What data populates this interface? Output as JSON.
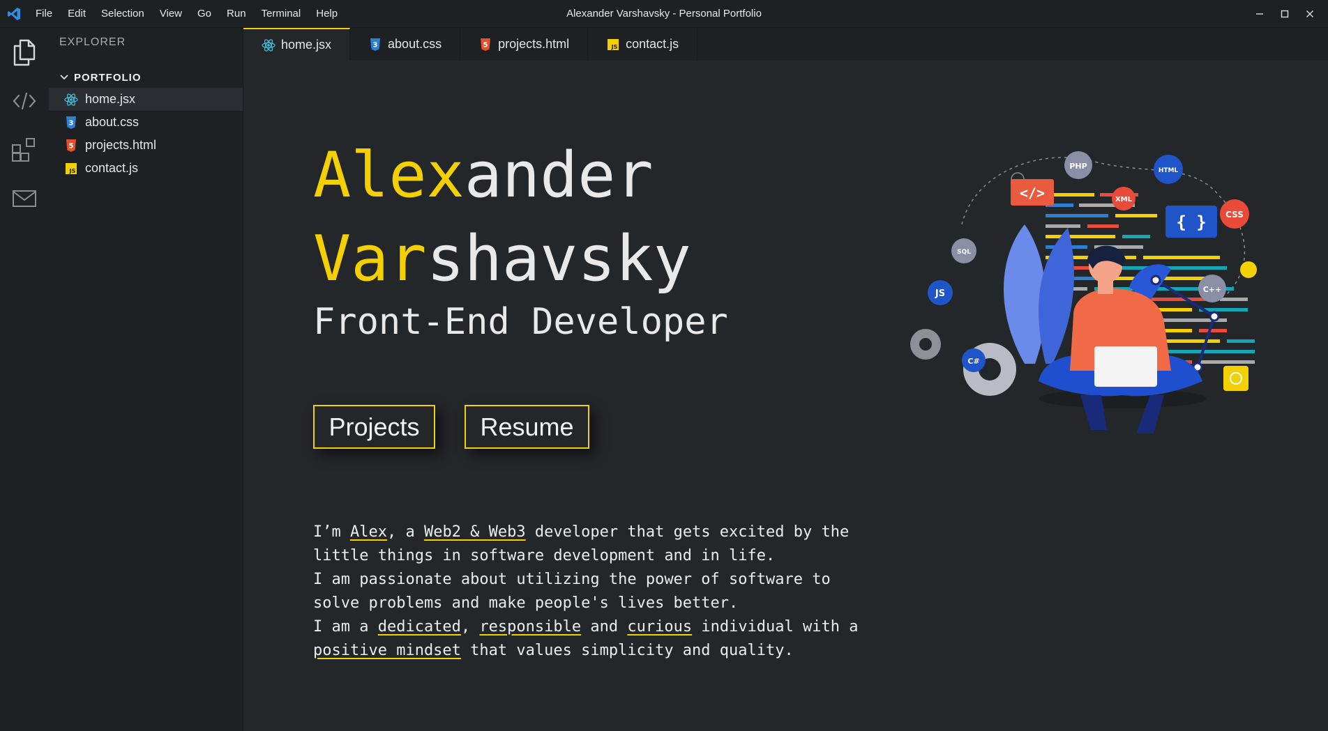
{
  "titlebar": {
    "menu": [
      "File",
      "Edit",
      "Selection",
      "View",
      "Go",
      "Run",
      "Terminal",
      "Help"
    ],
    "title": "Alexander Varshavsky - Personal Portfolio"
  },
  "sidebar": {
    "title": "EXPLORER",
    "folder": "PORTFOLIO",
    "files": [
      {
        "name": "home.jsx",
        "icon": "react-icon"
      },
      {
        "name": "about.css",
        "icon": "css-icon"
      },
      {
        "name": "projects.html",
        "icon": "html-icon"
      },
      {
        "name": "contact.js",
        "icon": "js-icon"
      }
    ]
  },
  "tabs": [
    {
      "label": "home.jsx"
    },
    {
      "label": "about.css"
    },
    {
      "label": "projects.html"
    },
    {
      "label": "contact.js"
    }
  ],
  "hero": {
    "first_hl": "Alex",
    "first_rest": "ander",
    "last_hl": "Var",
    "last_rest": "shavsky",
    "role": "Front-End Developer",
    "btn_projects": "Projects",
    "btn_resume": "Resume"
  },
  "about": {
    "p1_a": "I’m ",
    "p1_b": "Alex",
    "p1_c": ", a ",
    "p1_d": "Web2 & Web3",
    "p1_e": " developer that gets excited by the little things in software development and in life.",
    "p2": "I am passionate about utilizing the power of software to solve problems and make people's lives better.",
    "p3_a": "I am a ",
    "p3_b": "dedicated",
    "p3_c": ", ",
    "p3_d": "responsible",
    "p3_e": " and ",
    "p3_f": "curious",
    "p3_g": " individual with a ",
    "p3_h": "positive mindset",
    "p3_i": " that values simplicity and quality."
  },
  "illustration": {
    "badges": [
      "PHP",
      "HTML",
      "XML",
      "CSS",
      "SQL",
      "JS",
      "C++",
      "C#"
    ]
  },
  "colors": {
    "accent": "#f5d000",
    "background": "#23272a",
    "sidebar": "#1e2124"
  }
}
